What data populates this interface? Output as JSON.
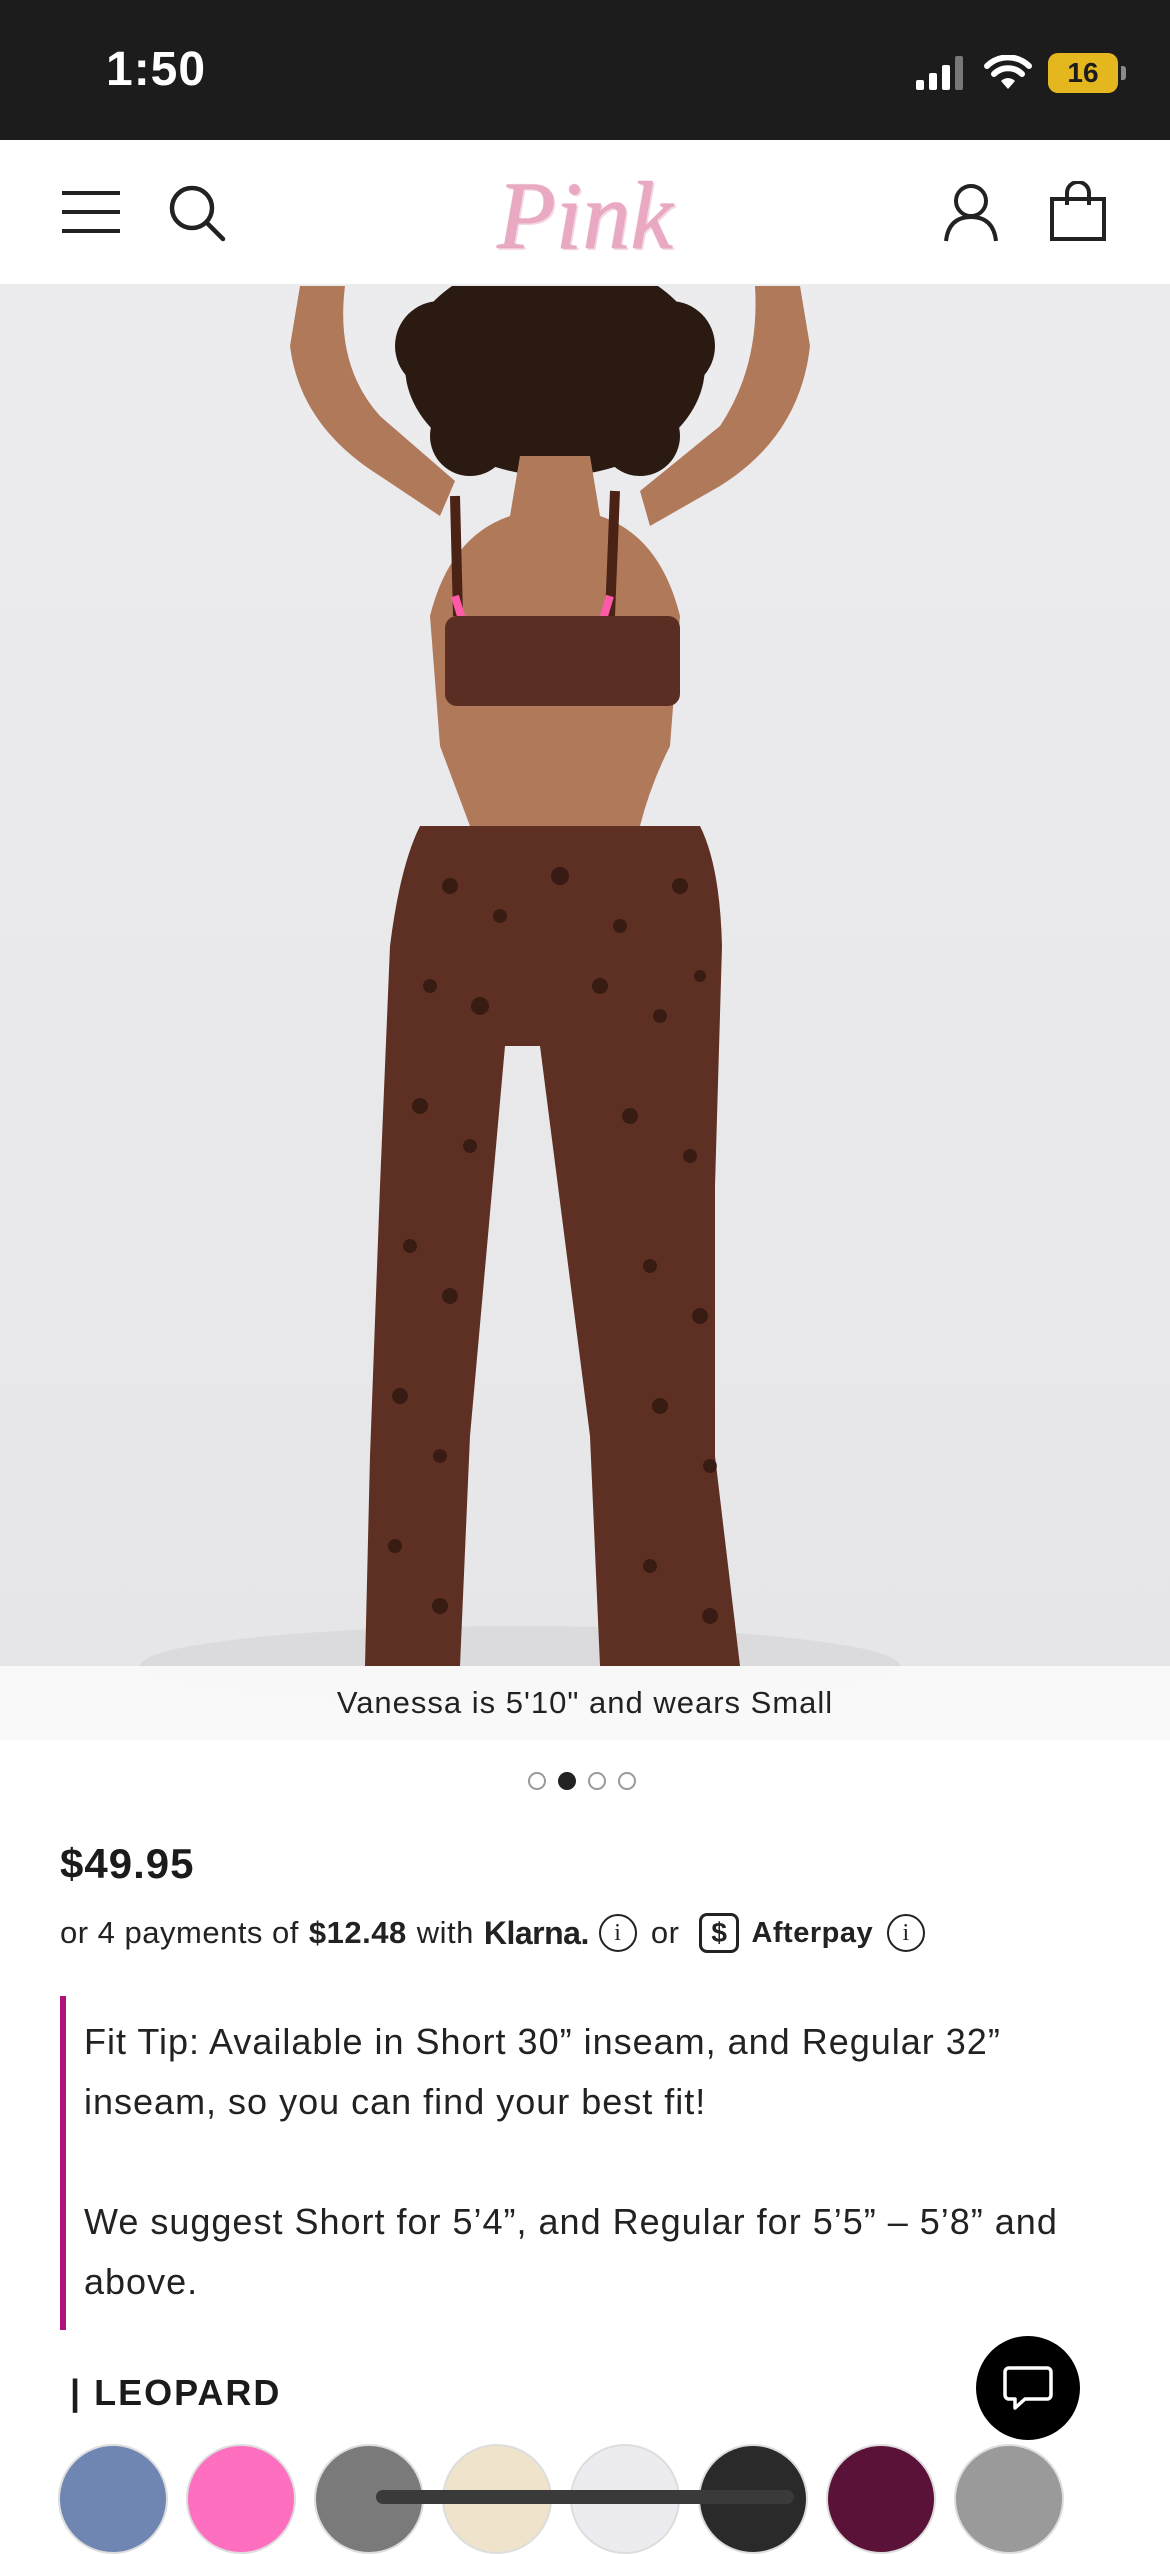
{
  "status_bar": {
    "time": "1:50",
    "battery": "16"
  },
  "header": {
    "logo_text": "Pink"
  },
  "hero": {
    "caption": "Vanessa is 5'10\" and wears Small",
    "slide_count": 4,
    "active_slide": 2
  },
  "product": {
    "price": "$49.95",
    "payments": {
      "prefix": "or 4 payments of",
      "amount": "$12.48",
      "with": "with",
      "klarna": "Klarna.",
      "or": "or",
      "afterpay_symbol": "$",
      "afterpay": "Afterpay",
      "info_glyph": "i"
    },
    "fit_tip": {
      "line1": "Fit Tip: Available in Short 30” inseam, and Regular 32” inseam, so you can find your best fit!",
      "line2": "We suggest Short for 5’4”, and Regular for 5’5” – 5’8” and above."
    },
    "color_label": "| LEOPARD",
    "swatches": [
      "#6f86b3",
      "#ff6fbf",
      "#7a7a7a",
      "#efe3cc",
      "#ececf0",
      "#2a2a2a",
      "#5a1238",
      "#9a9a9a"
    ]
  },
  "colors": {
    "accent": "#b0117a",
    "status_bg": "#1c1c1c",
    "battery": "#e5b71e"
  }
}
